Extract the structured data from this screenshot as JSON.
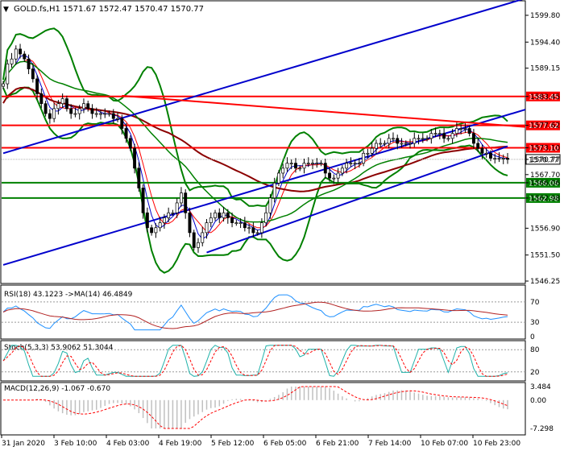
{
  "chart_data": [
    {
      "type": "candlestick",
      "symbol_line": {
        "symbol": "GOLD.fs,H1",
        "open": "1571.67",
        "high": "1572.47",
        "low": "1570.47",
        "close": "1570.77"
      },
      "y_ticks": [
        "1599.80",
        "1594.40",
        "1589.15",
        "1583.45",
        "1577.62",
        "1573.10",
        "1570.77",
        "1567.70",
        "1566.06",
        "1562.98",
        "1556.90",
        "1551.50",
        "1546.25"
      ],
      "ylim": [
        1546.25,
        1599.8
      ],
      "level_lines": [
        {
          "label": "1583.45",
          "value": 1583.45,
          "color": "#ff0000"
        },
        {
          "label": "1577.62",
          "value": 1577.62,
          "color": "#ff0000"
        },
        {
          "label": "1573.10",
          "value": 1573.1,
          "color": "#ff0000"
        },
        {
          "label": "1566.06",
          "value": 1566.06,
          "color": "#008000"
        },
        {
          "label": "1562.98",
          "value": 1562.98,
          "color": "#008000"
        }
      ],
      "current_price": {
        "label": "1570.77",
        "value": 1570.77
      },
      "trend_channel": {
        "lower": [
          [
            0,
            1549.5
          ],
          [
            119,
            1579.6
          ]
        ],
        "upper": [
          [
            0,
            1572.0
          ],
          [
            119,
            1602.0
          ]
        ],
        "color": "#0000cc"
      },
      "resistance_line": {
        "points": [
          [
            28,
            1583.6
          ],
          [
            119,
            1577.5
          ]
        ],
        "color": "#ff0000"
      },
      "close_series": [
        1586,
        1590,
        1591,
        1593,
        1592,
        1591,
        1589,
        1587,
        1584,
        1582,
        1580,
        1579,
        1581,
        1582,
        1583,
        1581,
        1580,
        1580,
        1581,
        1582,
        1581,
        1580,
        1580,
        1580,
        1580,
        1580,
        1579,
        1579,
        1577,
        1575,
        1573,
        1569,
        1565,
        1560,
        1557,
        1556,
        1557,
        1558,
        1559,
        1560,
        1560,
        1562,
        1564,
        1560,
        1556,
        1553,
        1554,
        1556,
        1558,
        1559,
        1560,
        1559,
        1560,
        1559,
        1558,
        1558,
        1558,
        1557,
        1557,
        1556,
        1556,
        1558,
        1560,
        1563,
        1566,
        1568,
        1569,
        1570,
        1570,
        1569,
        1569,
        1570,
        1570,
        1570,
        1570,
        1570,
        1568,
        1567,
        1567,
        1568,
        1569,
        1570,
        1570,
        1570,
        1570,
        1572,
        1572,
        1573,
        1574,
        1574,
        1574,
        1575,
        1575,
        1574,
        1574,
        1574,
        1574,
        1575,
        1575,
        1575,
        1575,
        1576,
        1576,
        1576,
        1575,
        1575,
        1576,
        1577,
        1577,
        1577,
        1576,
        1574,
        1573,
        1572,
        1572,
        1571,
        1571,
        1571,
        1571,
        1570.77
      ],
      "bollinger_color": "#008000",
      "ma_colors": {
        "fast": "#0000cc",
        "mid": "#ff0000",
        "slow": "#8b0000",
        "long": "#008000"
      },
      "x_tick_labels": [
        "31 Jan 2020",
        "3 Feb 10:00",
        "4 Feb 03:00",
        "4 Feb 19:00",
        "5 Feb 12:00",
        "6 Feb 05:00",
        "6 Feb 21:00",
        "7 Feb 14:00",
        "10 Feb 07:00",
        "10 Feb 23:00"
      ],
      "background": "#ffffff"
    },
    {
      "type": "line",
      "label": "RSI(18) 43.1223  ->MA(14) 46.4849",
      "levels": [
        70,
        30
      ],
      "level_labels": [
        "70",
        "30",
        "0"
      ],
      "series": [
        {
          "name": "RSI(18)",
          "color": "#1e90ff"
        },
        {
          "name": "MA(14)",
          "color": "#b22222"
        }
      ]
    },
    {
      "type": "line",
      "label": "Stoch(5,3,3) 53.9062 51.3044",
      "levels": [
        80,
        20
      ],
      "level_labels": [
        "80",
        "20"
      ],
      "series": [
        {
          "name": "%K",
          "color": "#20b2aa"
        },
        {
          "name": "%D",
          "color": "#ff0000"
        }
      ]
    },
    {
      "type": "bar",
      "label": "MACD(12,26,9) -1.067 -0.670",
      "y_ticks": [
        "3.484",
        "0.00",
        "-7.298"
      ],
      "ylim": [
        -7.298,
        3.484
      ],
      "series": [
        {
          "name": "MACD",
          "color": "#c0c0c0"
        },
        {
          "name": "Signal",
          "color": "#ff0000"
        }
      ]
    }
  ]
}
